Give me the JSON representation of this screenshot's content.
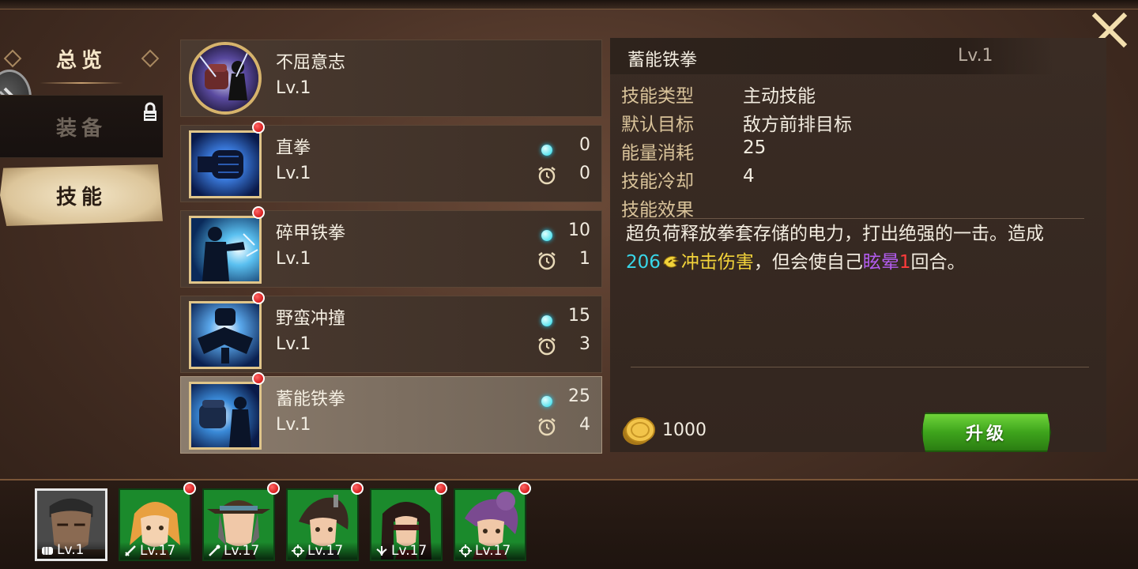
{
  "tabs": {
    "overview": "总览",
    "equipment": "装备",
    "skills": "技能"
  },
  "skills": [
    {
      "name": "不屈意志",
      "level": "Lv.1",
      "type": "passive"
    },
    {
      "name": "直拳",
      "level": "Lv.1",
      "energy": "0",
      "cooldown": "0",
      "new": true
    },
    {
      "name": "碎甲铁拳",
      "level": "Lv.1",
      "energy": "10",
      "cooldown": "1",
      "new": true
    },
    {
      "name": "野蛮冲撞",
      "level": "Lv.1",
      "energy": "15",
      "cooldown": "3",
      "new": true
    },
    {
      "name": "蓄能铁拳",
      "level": "Lv.1",
      "energy": "25",
      "cooldown": "4",
      "new": true,
      "selected": true
    }
  ],
  "detail": {
    "name": "蓄能铁拳",
    "level": "Lv.1",
    "labels": {
      "type": "技能类型",
      "target": "默认目标",
      "energy": "能量消耗",
      "cooldown": "技能冷却",
      "effect": "技能效果"
    },
    "values": {
      "type": "主动技能",
      "target": "敌方前排目标",
      "energy": "25",
      "cooldown": "4"
    },
    "description": {
      "part1": "超负荷释放拳套存储的电力，打出绝强的一击。造成",
      "damage_value": "206",
      "damage_type": "冲击伤害",
      "part2": "，但会使自己",
      "status": "眩晕",
      "status_turns": "1",
      "part3": "回合。"
    },
    "cost": "1000",
    "upgrade_label": "升级"
  },
  "heroes": [
    {
      "level": "Lv.1",
      "role": "fist",
      "selected": true,
      "frame": "gray"
    },
    {
      "level": "Lv.17",
      "role": "sword",
      "new": true,
      "frame": "green"
    },
    {
      "level": "Lv.17",
      "role": "wand",
      "new": true,
      "frame": "green"
    },
    {
      "level": "Lv.17",
      "role": "crosshair",
      "new": true,
      "frame": "green"
    },
    {
      "level": "Lv.17",
      "role": "heal",
      "new": true,
      "frame": "green"
    },
    {
      "level": "Lv.17",
      "role": "crosshair",
      "new": true,
      "frame": "green"
    }
  ],
  "colors": {
    "energy": "#22d8e8",
    "damage_value": "#38d6e8",
    "damage_type": "#f2d33a",
    "status": "#b35cf0",
    "status_turns": "#ff3b3b",
    "upgrade_button": "#3ea41c"
  }
}
